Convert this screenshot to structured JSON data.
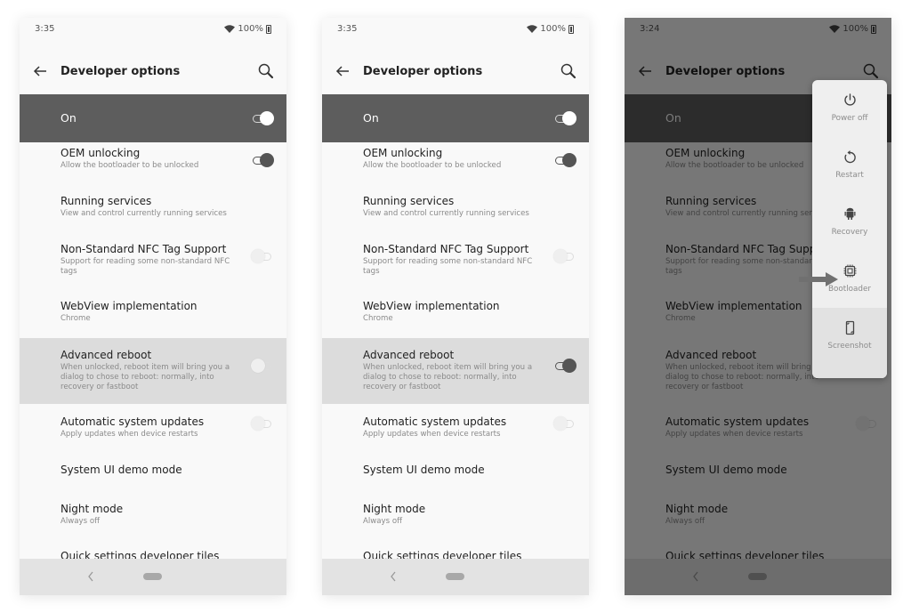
{
  "screens": [
    {
      "status": {
        "time": "3:35",
        "battery": "100%"
      },
      "title": "Developer options",
      "master": {
        "label": "On",
        "toggle": "on"
      },
      "items": [
        {
          "title": "OEM unlocking",
          "subtitle": "Allow the bootloader to be unlocked",
          "toggle": "on"
        },
        {
          "title": "Running services",
          "subtitle": "View and control currently running services"
        },
        {
          "title": "Non-Standard NFC Tag Support",
          "subtitle": "Support for reading some non-standard NFC tags",
          "toggle": "off"
        },
        {
          "title": "WebView implementation",
          "subtitle": "Chrome"
        },
        {
          "title": "Advanced reboot",
          "subtitle": "When unlocked, reboot item will bring you a dialog to chose to reboot: normally, into recovery or fastboot",
          "toggle": "off",
          "highlighted": true
        },
        {
          "title": "Automatic system updates",
          "subtitle": "Apply updates when device restarts",
          "toggle": "off"
        },
        {
          "title": "System UI demo mode"
        },
        {
          "title": "Night mode",
          "subtitle": "Always off"
        },
        {
          "title": "Quick settings developer tiles"
        }
      ]
    },
    {
      "status": {
        "time": "3:35",
        "battery": "100%"
      },
      "title": "Developer options",
      "master": {
        "label": "On",
        "toggle": "on"
      },
      "items": [
        {
          "title": "OEM unlocking",
          "subtitle": "Allow the bootloader to be unlocked",
          "toggle": "on"
        },
        {
          "title": "Running services",
          "subtitle": "View and control currently running services"
        },
        {
          "title": "Non-Standard NFC Tag Support",
          "subtitle": "Support for reading some non-standard NFC tags",
          "toggle": "off"
        },
        {
          "title": "WebView implementation",
          "subtitle": "Chrome"
        },
        {
          "title": "Advanced reboot",
          "subtitle": "When unlocked, reboot item will bring you a dialog to chose to reboot: normally, into recovery or fastboot",
          "toggle": "on",
          "highlighted": true
        },
        {
          "title": "Automatic system updates",
          "subtitle": "Apply updates when device restarts",
          "toggle": "off"
        },
        {
          "title": "System UI demo mode"
        },
        {
          "title": "Night mode",
          "subtitle": "Always off"
        },
        {
          "title": "Quick settings developer tiles"
        }
      ]
    },
    {
      "status": {
        "time": "3:24",
        "battery": "100%"
      },
      "title": "Developer options",
      "master": {
        "label": "On",
        "toggle": "on"
      },
      "items": [
        {
          "title": "OEM unlocking",
          "subtitle": "Allow the bootloader to be unlocked",
          "toggle": "on"
        },
        {
          "title": "Running services",
          "subtitle": "View and control currently running services"
        },
        {
          "title": "Non-Standard NFC Tag Support",
          "subtitle": "Support for reading some non-standard NFC tags",
          "toggle": "off"
        },
        {
          "title": "WebView implementation",
          "subtitle": "Chrome"
        },
        {
          "title": "Advanced reboot",
          "subtitle": "When unlocked, reboot item will bring you a dialog to chose to reboot: normally, into recovery or fastboot",
          "toggle": "on"
        },
        {
          "title": "Automatic system updates",
          "subtitle": "Apply updates when device restarts",
          "toggle": "off"
        },
        {
          "title": "System UI demo mode"
        },
        {
          "title": "Night mode",
          "subtitle": "Always off"
        },
        {
          "title": "Quick settings developer tiles"
        }
      ],
      "power_menu": [
        {
          "label": "Power off",
          "icon": "power-icon"
        },
        {
          "label": "Restart",
          "icon": "restart-icon"
        },
        {
          "label": "Recovery",
          "icon": "android-icon"
        },
        {
          "label": "Bootloader",
          "icon": "chip-icon"
        },
        {
          "label": "Screenshot",
          "icon": "phone-screenshot-icon"
        }
      ]
    }
  ]
}
